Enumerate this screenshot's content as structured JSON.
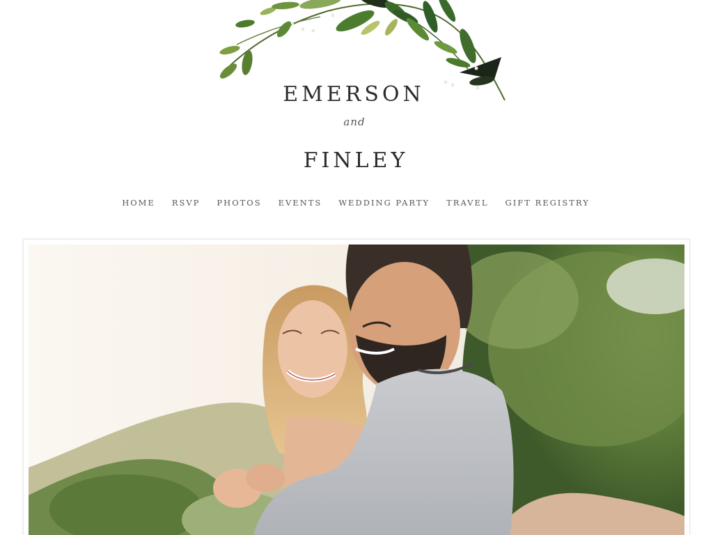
{
  "couple": {
    "first_name": "EMERSON",
    "conjunction": "and",
    "second_name": "FINLEY"
  },
  "nav": {
    "items": [
      {
        "label": "HOME"
      },
      {
        "label": "RSVP"
      },
      {
        "label": "PHOTOS"
      },
      {
        "label": "EVENTS"
      },
      {
        "label": "WEDDING PARTY"
      },
      {
        "label": "TRAVEL"
      },
      {
        "label": "GIFT REGISTRY"
      }
    ]
  },
  "colors": {
    "background": "#ffffff",
    "text": "#2b2b2b",
    "nav_text": "#555555",
    "foliage_dark": "#1f2f1c",
    "foliage_green": "#4e7a2e",
    "foliage_light": "#8fae4a"
  },
  "icons": {
    "header_decoration": "foliage-garland"
  }
}
